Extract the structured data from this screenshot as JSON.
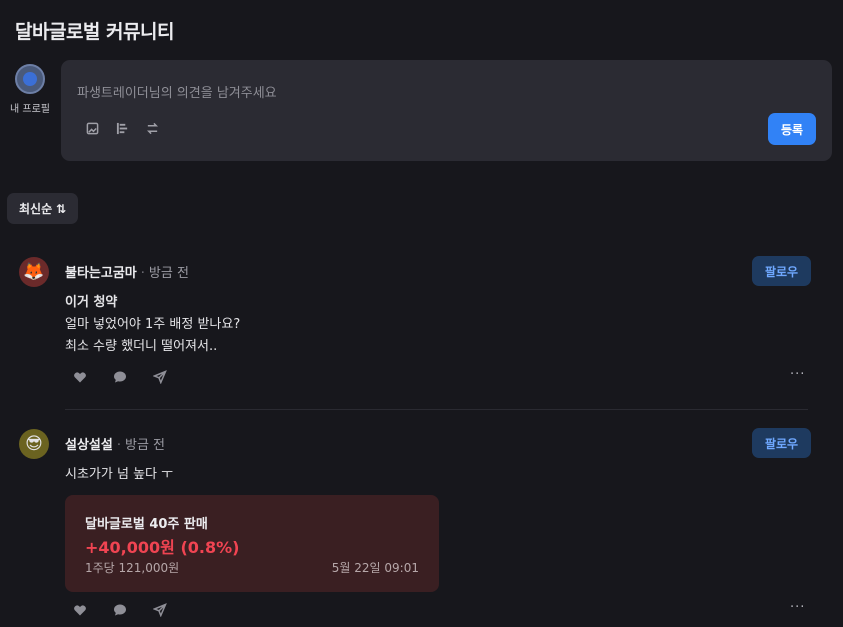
{
  "page": {
    "title": "달바글로벌 커뮤니티"
  },
  "profile": {
    "label": "내 프로필"
  },
  "composer": {
    "placeholder": "파생트레이더님의 의견을 남겨주세요",
    "submit_label": "등록"
  },
  "sort": {
    "label": "최신순",
    "icon": "sort-arrows-icon"
  },
  "posts": [
    {
      "author": "불타는고굼마",
      "time": "방금 전",
      "follow_label": "팔로우",
      "avatar_icon": "fox-avatar",
      "avatar_emoji": "🦊",
      "avatar_color": "#6b2a2a",
      "title": "이거 청약",
      "lines": [
        "얼마 넣었어야 1주 배정 받나요?",
        "최소 수량 했더니 떨어져서.."
      ]
    },
    {
      "author": "설상설설",
      "time": "방금 전",
      "follow_label": "팔로우",
      "avatar_icon": "sunglasses-avatar",
      "avatar_emoji": "😎",
      "avatar_color": "#6b6320",
      "lines": [
        "시초가가 넘 높다 ㅜ"
      ],
      "trade": {
        "title": "달바글로벌 40주 판매",
        "amount": "+40,000원 (0.8%)",
        "unit_price": "1주당 121,000원",
        "date": "5월 22일 09:01",
        "amount_color": "#f04452"
      }
    }
  ],
  "actions": {
    "like_icon": "heart-icon",
    "comment_icon": "comment-icon",
    "share_icon": "send-icon",
    "more_label": "···"
  },
  "colors": {
    "accent": "#3182f6",
    "background": "#17171c",
    "panel": "#2b2b33",
    "follow_bg": "#1e3a5f",
    "follow_text": "#6fa8ff"
  }
}
